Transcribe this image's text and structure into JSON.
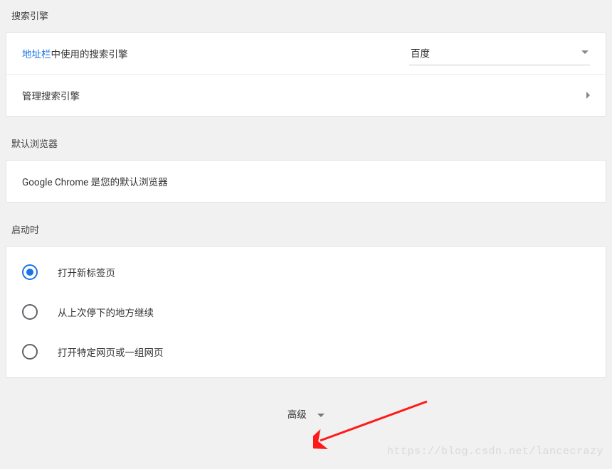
{
  "search_engine": {
    "title": "搜索引擎",
    "address_bar_link": "地址栏",
    "address_bar_rest": "中使用的搜索引擎",
    "selected_engine": "百度",
    "manage_label": "管理搜索引擎"
  },
  "default_browser": {
    "title": "默认浏览器",
    "status": "Google Chrome 是您的默认浏览器"
  },
  "startup": {
    "title": "启动时",
    "options": [
      {
        "label": "打开新标签页",
        "selected": true
      },
      {
        "label": "从上次停下的地方继续",
        "selected": false
      },
      {
        "label": "打开特定网页或一组网页",
        "selected": false
      }
    ]
  },
  "advanced_label": "高级",
  "watermark": "https://blog.csdn.net/lancecrazy"
}
